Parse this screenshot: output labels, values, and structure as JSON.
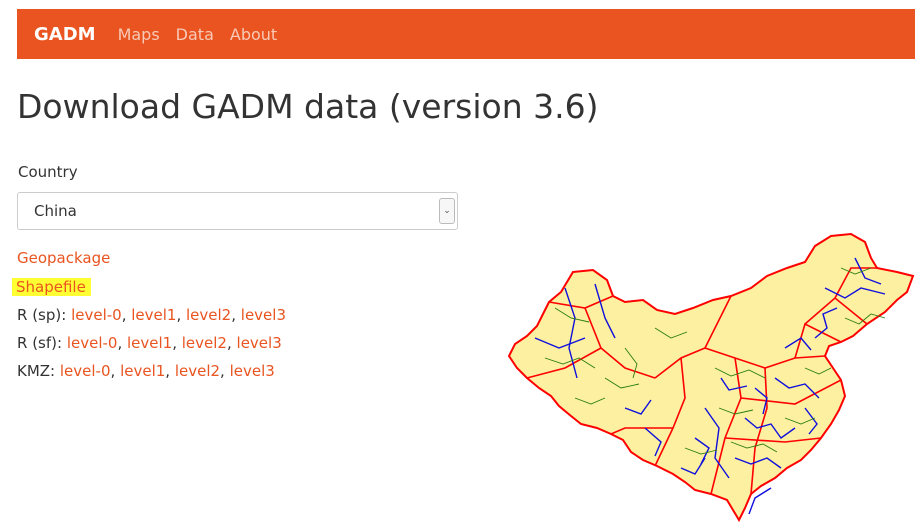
{
  "navbar": {
    "brand": "GADM",
    "links": [
      "Maps",
      "Data",
      "About"
    ]
  },
  "page": {
    "title": "Download GADM data (version 3.6)"
  },
  "country": {
    "label": "Country",
    "selected": "China"
  },
  "downloads": {
    "geopackage": "Geopackage",
    "shapefile": "Shapefile",
    "rows": [
      {
        "prefix": "R (sp):",
        "links": [
          "level-0",
          "level1",
          "level2",
          "level3"
        ]
      },
      {
        "prefix": "R (sf):",
        "links": [
          "level-0",
          "level1",
          "level2",
          "level3"
        ]
      },
      {
        "prefix": "KMZ:",
        "links": [
          "level-0",
          "level1",
          "level2",
          "level3"
        ]
      }
    ]
  },
  "colors": {
    "accent": "#e95420",
    "highlight": "#ffff33",
    "map_fill": "#fdf0a0",
    "map_border": "#ff0000",
    "map_lines_blue": "#1010dd",
    "map_lines_green": "#2a7d10"
  }
}
